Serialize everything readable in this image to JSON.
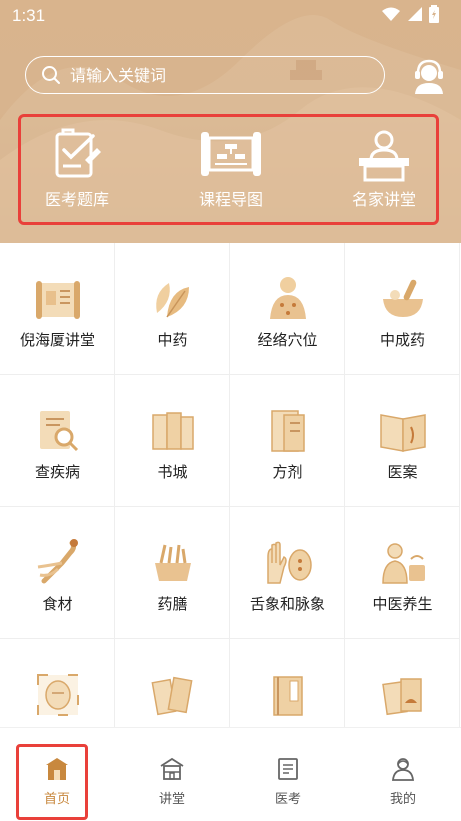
{
  "status": {
    "time": "1:31"
  },
  "search": {
    "placeholder": "请输入关键词"
  },
  "features": [
    {
      "label": "医考题库",
      "icon": "exam-bank-icon"
    },
    {
      "label": "课程导图",
      "icon": "course-map-icon"
    },
    {
      "label": "名家讲堂",
      "icon": "lecture-hall-icon"
    }
  ],
  "grid": [
    {
      "label": "倪海厦讲堂",
      "icon": "scroll-icon"
    },
    {
      "label": "中药",
      "icon": "leaf-icon"
    },
    {
      "label": "经络穴位",
      "icon": "acupoint-icon"
    },
    {
      "label": "中成药",
      "icon": "mortar-icon"
    },
    {
      "label": "查疾病",
      "icon": "disease-search-icon"
    },
    {
      "label": "书城",
      "icon": "books-icon"
    },
    {
      "label": "方剂",
      "icon": "prescription-icon"
    },
    {
      "label": "医案",
      "icon": "case-book-icon"
    },
    {
      "label": "食材",
      "icon": "ginseng-icon"
    },
    {
      "label": "药膳",
      "icon": "herb-bowl-icon"
    },
    {
      "label": "舌象和脉象",
      "icon": "tongue-pulse-icon"
    },
    {
      "label": "中医养生",
      "icon": "wellness-icon"
    },
    {
      "label": "",
      "icon": "frame-icon"
    },
    {
      "label": "",
      "icon": "scroll-books-icon"
    },
    {
      "label": "",
      "icon": "manual-icon"
    },
    {
      "label": "",
      "icon": "tea-book-icon"
    }
  ],
  "nav": [
    {
      "label": "首页",
      "icon": "home-icon"
    },
    {
      "label": "讲堂",
      "icon": "classroom-icon"
    },
    {
      "label": "医考",
      "icon": "exam-icon"
    },
    {
      "label": "我的",
      "icon": "profile-icon"
    }
  ],
  "colors": {
    "accent": "#c8883e",
    "header": "#d8b48e",
    "highlight": "#e9403a"
  }
}
